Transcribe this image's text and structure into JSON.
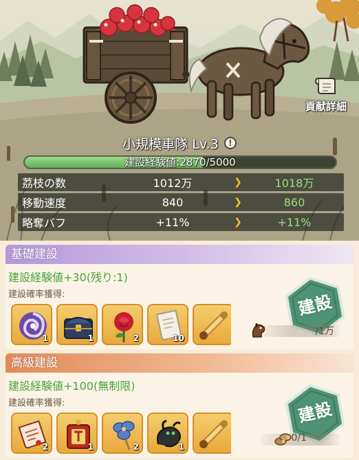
{
  "details_button": {
    "label": "貢献詳細",
    "icon": "scroll-icon"
  },
  "caravan": {
    "name": "小規模車隊 Lv.3",
    "experience": {
      "text": "建設経験値:2870/5000",
      "current": 2870,
      "max": 5000
    }
  },
  "stats": [
    {
      "name": "茘枝の数",
      "current": "1012万",
      "next": "1018万"
    },
    {
      "name": "移動速度",
      "current": "840",
      "next": "860"
    },
    {
      "name": "略奪バフ",
      "current": "+11%",
      "next": "+11%"
    }
  ],
  "arrow_glyph": "❯",
  "basic_build": {
    "title": "基礎建設",
    "gain": "建設経験値+30(残り:1)",
    "drop_label": "建設確率獲得:",
    "items": [
      {
        "icon": "purple-vortex-icon",
        "count": "1"
      },
      {
        "icon": "treasure-chest-icon",
        "count": "1"
      },
      {
        "icon": "red-rose-icon",
        "count": "2"
      },
      {
        "icon": "paper-scroll-icon",
        "count": "10"
      },
      {
        "icon": "golden-scroll-icon",
        "count": ""
      }
    ],
    "button_label": "建設",
    "cost": {
      "icon": "horse-icon",
      "text": "/1万"
    }
  },
  "advanced_build": {
    "title": "高級建設",
    "gain": "建設経験値+100(無制限)",
    "drop_label": "建設確率獲得:",
    "items": [
      {
        "icon": "red-scroll-icon",
        "count": "2"
      },
      {
        "icon": "red-token-icon",
        "count": "1"
      },
      {
        "icon": "blue-flower-icon",
        "count": "2"
      },
      {
        "icon": "black-dragon-icon",
        "count": "1"
      },
      {
        "icon": "golden-scroll-icon",
        "count": ""
      }
    ],
    "button_label": "建設",
    "cost": {
      "icon": "wood-logs-icon",
      "text": "0/1"
    }
  },
  "colors": {
    "green_text": "#4aa33f",
    "next_value": "#9be07f",
    "arrow": "#f2c230",
    "basic_header": "#b697dc",
    "advanced_header": "#e18a5a",
    "build_button": "#4f9275"
  }
}
